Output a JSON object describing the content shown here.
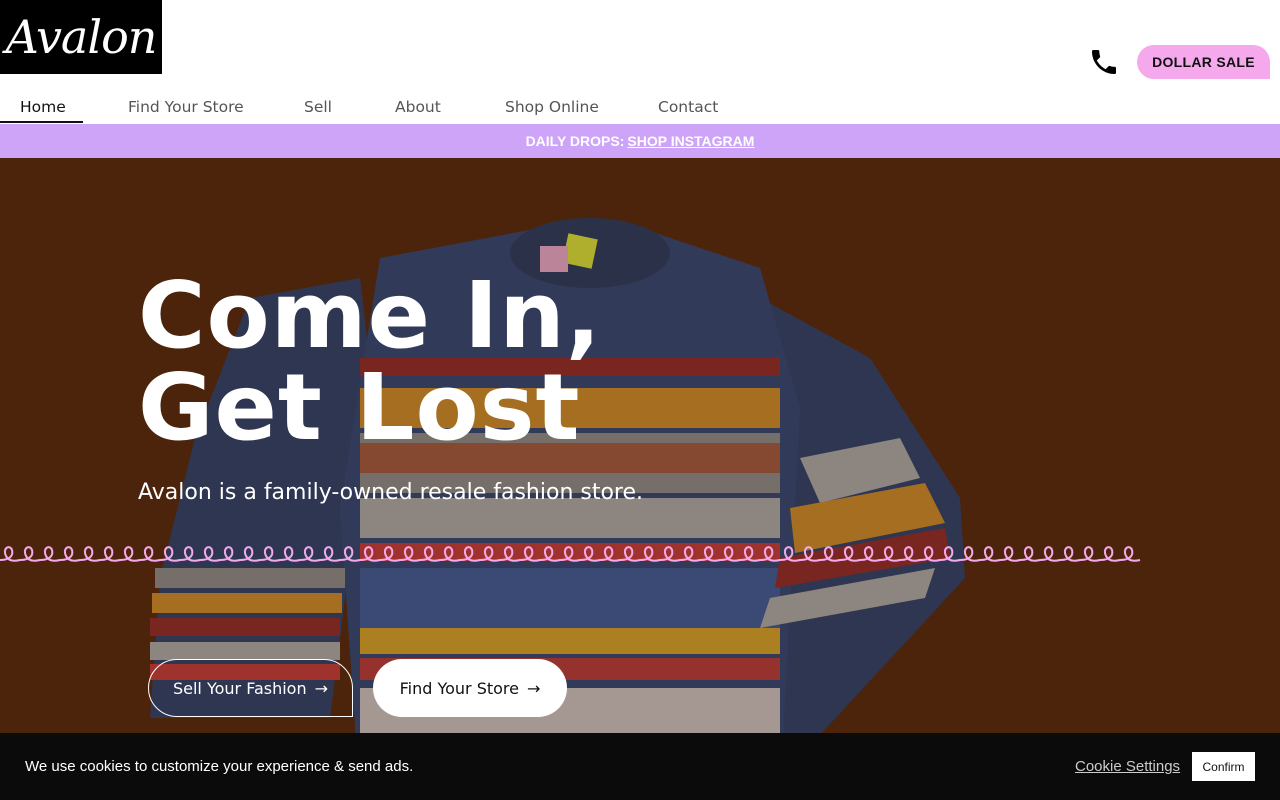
{
  "header": {
    "logo_text": "Avalon",
    "phone_icon": "phone-icon",
    "dollar_sale_label": "DOLLAR SALE"
  },
  "nav": {
    "items": [
      {
        "label": "Home",
        "active": true
      },
      {
        "label": "Find Your Store"
      },
      {
        "label": "Sell"
      },
      {
        "label": "About"
      },
      {
        "label": "Shop Online"
      },
      {
        "label": "Contact"
      }
    ]
  },
  "announcement": {
    "prefix": "DAILY DROPS:",
    "link_label": "SHOP INSTAGRAM"
  },
  "hero": {
    "title_line1": "Come In,",
    "title_line2": "Get Lost",
    "subtitle": "Avalon is a family-owned resale fashion store.",
    "buttons": {
      "sell_label": "Sell Your Fashion",
      "find_store_label": "Find Your Store",
      "arrow": "→"
    }
  },
  "cookie_banner": {
    "message": "We use cookies to customize your experience & send ads.",
    "settings_label": "Cookie Settings",
    "confirm_label": "Confirm"
  },
  "colors": {
    "hero_bg": "#52270e",
    "announcement_bg": "#cda4f7",
    "dollar_sale_bg": "#f5a8ec",
    "squiggle": "#f5a8ec",
    "cookie_bg": "#0b0b0b"
  }
}
